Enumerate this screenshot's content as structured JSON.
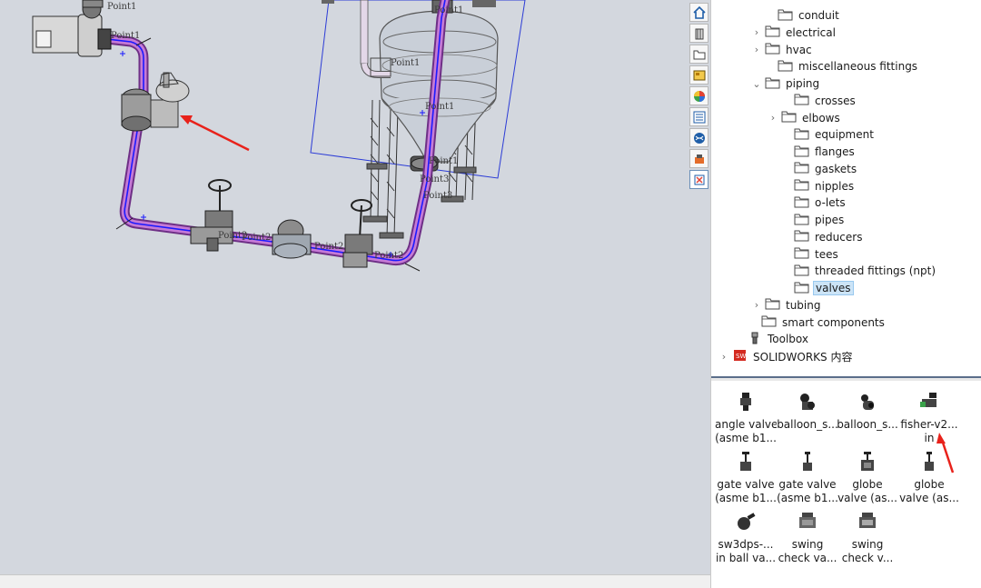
{
  "viewport": {
    "point_labels": [
      "Point1",
      "Point1",
      "Point1",
      "Point1",
      "Point1",
      "Point1",
      "Point2",
      "Point2",
      "Point3",
      "Point3",
      "Point2",
      "Point2"
    ]
  },
  "icon_strip": {
    "buttons": [
      "home-icon",
      "parts-library-icon",
      "file-explorer-icon",
      "view-palette-icon",
      "appearances-icon",
      "custom-properties-icon",
      "solidworks-forum-icon",
      "3d-content-icon",
      "design-library-icon"
    ]
  },
  "tree": {
    "items": [
      {
        "label": "conduit",
        "chevron": ""
      },
      {
        "label": "electrical",
        "chevron": ">"
      },
      {
        "label": "hvac",
        "chevron": ">"
      },
      {
        "label": "miscellaneous fittings",
        "chevron": ""
      },
      {
        "label": "piping",
        "chevron": "v"
      },
      {
        "label": "crosses",
        "chevron": ""
      },
      {
        "label": "elbows",
        "chevron": ">"
      },
      {
        "label": "equipment",
        "chevron": ""
      },
      {
        "label": "flanges",
        "chevron": ""
      },
      {
        "label": "gaskets",
        "chevron": ""
      },
      {
        "label": "nipples",
        "chevron": ""
      },
      {
        "label": "o-lets",
        "chevron": ""
      },
      {
        "label": "pipes",
        "chevron": ""
      },
      {
        "label": "reducers",
        "chevron": ""
      },
      {
        "label": "tees",
        "chevron": ""
      },
      {
        "label": "threaded fittings (npt)",
        "chevron": ""
      },
      {
        "label": "valves",
        "chevron": ""
      },
      {
        "label": "tubing",
        "chevron": ">"
      },
      {
        "label": "smart components",
        "chevron": ""
      },
      {
        "label": "Toolbox",
        "chevron": ""
      },
      {
        "label": "SOLIDWORKS 内容",
        "chevron": ">"
      }
    ]
  },
  "palette": {
    "components": [
      {
        "line1": "angle valve",
        "line2": "(asme b1..."
      },
      {
        "line1": "balloon_s...",
        "line2": ""
      },
      {
        "line1": "balloon_s...",
        "line2": ""
      },
      {
        "line1": "fisher-v2...",
        "line2": "in"
      },
      {
        "line1": "gate valve",
        "line2": "(asme b1..."
      },
      {
        "line1": "gate valve",
        "line2": "(asme b1..."
      },
      {
        "line1": "globe",
        "line2": "valve (as..."
      },
      {
        "line1": "globe",
        "line2": "valve (as..."
      },
      {
        "line1": "sw3dps-...",
        "line2": "in ball va..."
      },
      {
        "line1": "swing",
        "line2": "check va..."
      },
      {
        "line1": "swing",
        "line2": "check v..."
      }
    ]
  },
  "colors": {
    "viewport_bg": "#d3d7de",
    "pipe": "#b864c8",
    "route_line": "#1a1aff",
    "annotation_arrow": "#e8221b",
    "selection": "#cce4f7"
  }
}
